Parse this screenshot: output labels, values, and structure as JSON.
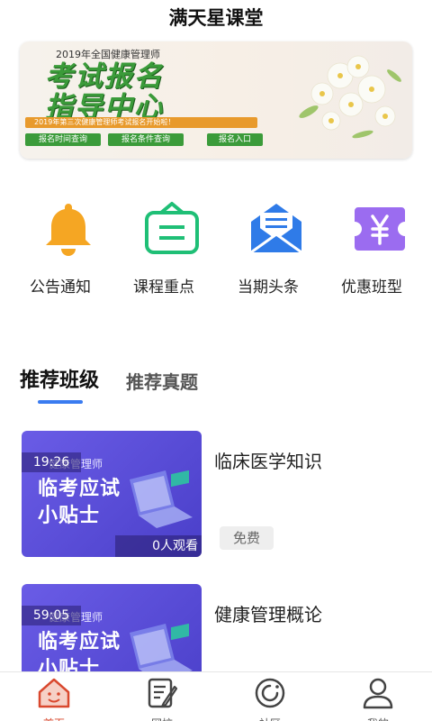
{
  "header": {
    "title": "满天星课堂"
  },
  "banner": {
    "top_text": "2019年全国健康管理师",
    "main_line1": "考试报名",
    "main_line2": "指导中心",
    "strip_text": "2019年第三次健康管理师考试报名开始啦！",
    "buttons": [
      "报名时间查询",
      "报名条件查询",
      "报名入口"
    ]
  },
  "quick_links": [
    {
      "label": "公告通知",
      "icon": "bell-icon",
      "color": "#f5a623"
    },
    {
      "label": "课程重点",
      "icon": "notice-board-icon",
      "color": "#1fbf76"
    },
    {
      "label": "当期头条",
      "icon": "envelope-icon",
      "color": "#2f7be8"
    },
    {
      "label": "优惠班型",
      "icon": "yen-ticket-icon",
      "color": "#9b6cf0"
    }
  ],
  "tabs": [
    {
      "label": "推荐班级",
      "active": true
    },
    {
      "label": "推荐真题",
      "active": false
    }
  ],
  "courses": [
    {
      "title": "临床医学知识",
      "duration": "19:26",
      "thumb_sub": "健康管理师",
      "thumb_main_1": "临考应试",
      "thumb_main_2": "小贴士",
      "views": "0人观看",
      "badge": "免费"
    },
    {
      "title": "健康管理概论",
      "duration": "59:05",
      "thumb_sub": "健康管理师",
      "thumb_main_1": "临考应试",
      "thumb_main_2": "小贴士"
    }
  ],
  "tabbar": [
    {
      "label": "首页",
      "icon": "home-icon",
      "active": true
    },
    {
      "label": "网校",
      "icon": "notebook-pen-icon",
      "active": false
    },
    {
      "label": "社区",
      "icon": "community-ring-icon",
      "active": false
    },
    {
      "label": "我的",
      "icon": "person-icon",
      "active": false
    }
  ],
  "colors": {
    "accent": "#3a7bf0",
    "active_tab": "#d9482e",
    "banner_green": "#3b9b3a",
    "thumb_purple": "#5a4ed8"
  }
}
